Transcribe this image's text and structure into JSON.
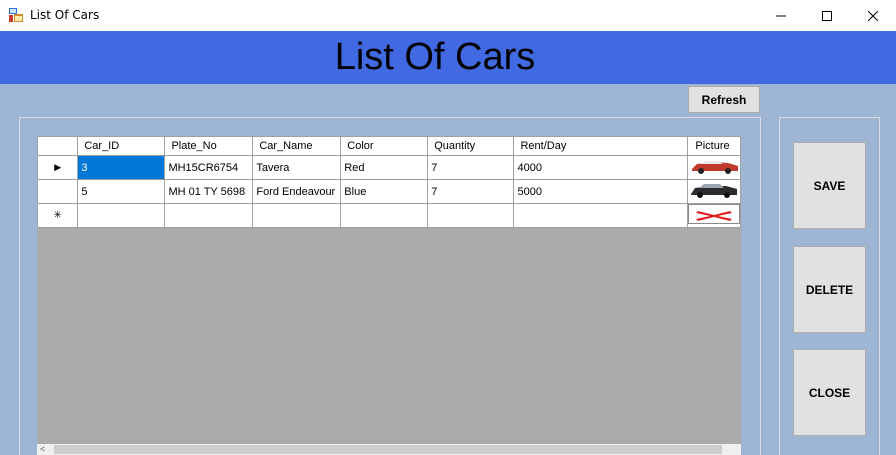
{
  "window": {
    "title": "List Of Cars"
  },
  "header": {
    "title": "List Of Cars"
  },
  "toolbar": {
    "refresh_label": "Refresh"
  },
  "actions": {
    "save_label": "SAVE",
    "delete_label": "DELETE",
    "close_label": "CLOSE"
  },
  "grid": {
    "columns": [
      "Car_ID",
      "Plate_No",
      "Car_Name",
      "Color",
      "Quantity",
      "Rent/Day",
      "Picture"
    ],
    "rows": [
      {
        "car_id": "3",
        "plate_no": "MH15CR6754",
        "car_name": "Tavera",
        "color": "Red",
        "quantity": "7",
        "rent": "4000",
        "picture": "red-car-thumbnail"
      },
      {
        "car_id": "5",
        "plate_no": "MH 01 TY 5698",
        "car_name": "Ford Endeavour",
        "color": "Blue",
        "quantity": "7",
        "rent": "5000",
        "picture": "dark-car-thumbnail"
      }
    ],
    "new_row_marker": "✳",
    "current_row_marker": "▶"
  },
  "icons": {
    "app": "app-form-icon",
    "minimize": "minimize-icon",
    "maximize": "maximize-icon",
    "close": "close-icon"
  },
  "colors": {
    "header_bg": "#4169e1",
    "form_bg": "#9eb6d3",
    "selection": "#0078d7",
    "grid_empty": "#ababab"
  }
}
